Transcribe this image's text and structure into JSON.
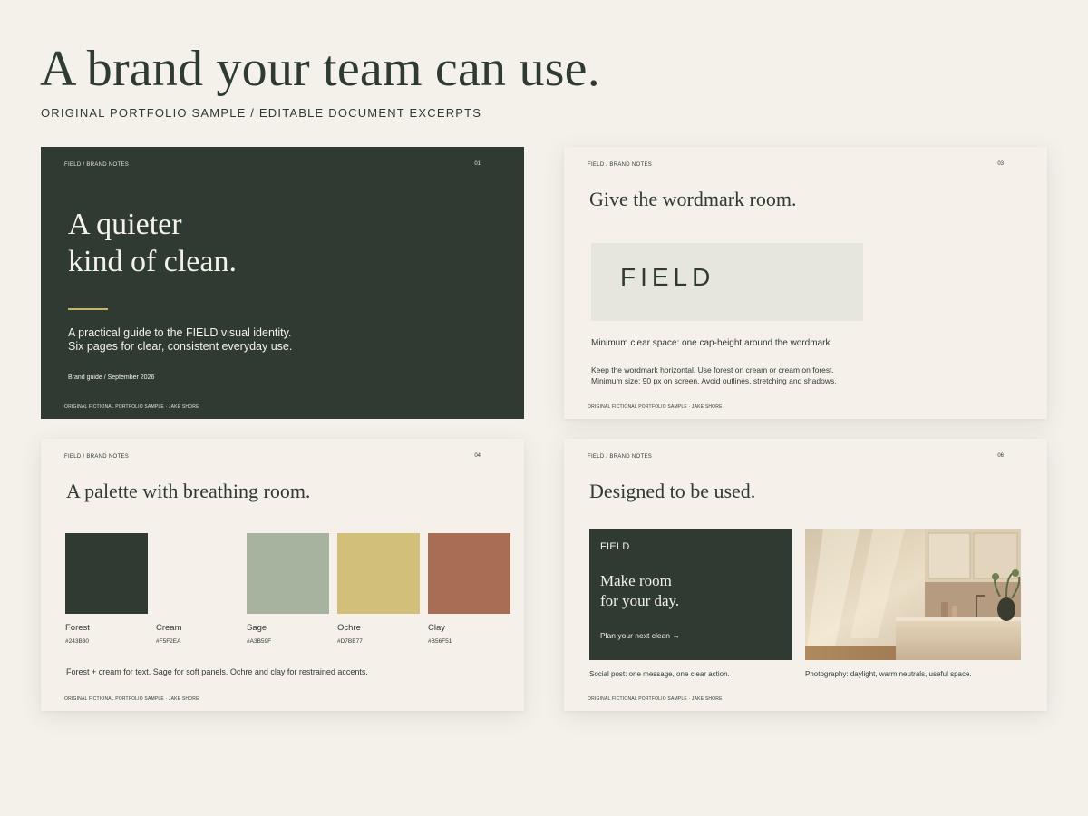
{
  "header": {
    "title": "A brand your team can use.",
    "subtitle": "ORIGINAL PORTFOLIO SAMPLE / EDITABLE DOCUMENT EXCERPTS"
  },
  "cards": [
    {
      "crumb": "FIELD  /  BRAND NOTES",
      "page": "01",
      "headline": "A quieter\nkind of clean.",
      "description": "A practical guide to the FIELD visual identity.\nSix pages for clear, consistent everyday use.",
      "meta": "Brand guide / September 2026",
      "footer": "ORIGINAL FICTIONAL PORTFOLIO SAMPLE · JAKE SHORE"
    },
    {
      "crumb": "FIELD  /  BRAND NOTES",
      "page": "03",
      "heading": "Give the wordmark room.",
      "wordmark": "FIELD",
      "note_clear_space": "Minimum clear space: one cap-height around the wordmark.",
      "note_usage": "Keep the wordmark horizontal. Use forest on cream or cream on forest.\nMinimum size: 90 px on screen. Avoid outlines, stretching and shadows.",
      "footer": "ORIGINAL FICTIONAL PORTFOLIO SAMPLE · JAKE SHORE"
    },
    {
      "crumb": "FIELD  /  BRAND NOTES",
      "page": "04",
      "heading": "A palette with breathing room.",
      "swatches": [
        {
          "name": "Forest",
          "hex": "#243B30",
          "color": "#2F3B32"
        },
        {
          "name": "Cream",
          "hex": "#F5F2EA",
          "color": "#F5F1EA"
        },
        {
          "name": "Sage",
          "hex": "#A3B59F",
          "color": "#A7B29F"
        },
        {
          "name": "Ochre",
          "hex": "#D7BE77",
          "color": "#D2C07A"
        },
        {
          "name": "Clay",
          "hex": "#B56F51",
          "color": "#A76E55"
        }
      ],
      "note": "Forest + cream for text. Sage for soft panels. Ochre and clay for restrained accents.",
      "footer": "ORIGINAL FICTIONAL PORTFOLIO SAMPLE · JAKE SHORE"
    },
    {
      "crumb": "FIELD  /  BRAND NOTES",
      "page": "06",
      "heading": "Designed to be used.",
      "social_brand": "FIELD",
      "social_message": "Make room\nfor your day.",
      "social_cta": "Plan your next clean →",
      "caption_social": "Social post: one message, one clear action.",
      "caption_photo": "Photography: daylight, warm neutrals, useful space.",
      "footer": "ORIGINAL FICTIONAL PORTFOLIO SAMPLE · JAKE SHORE"
    }
  ]
}
